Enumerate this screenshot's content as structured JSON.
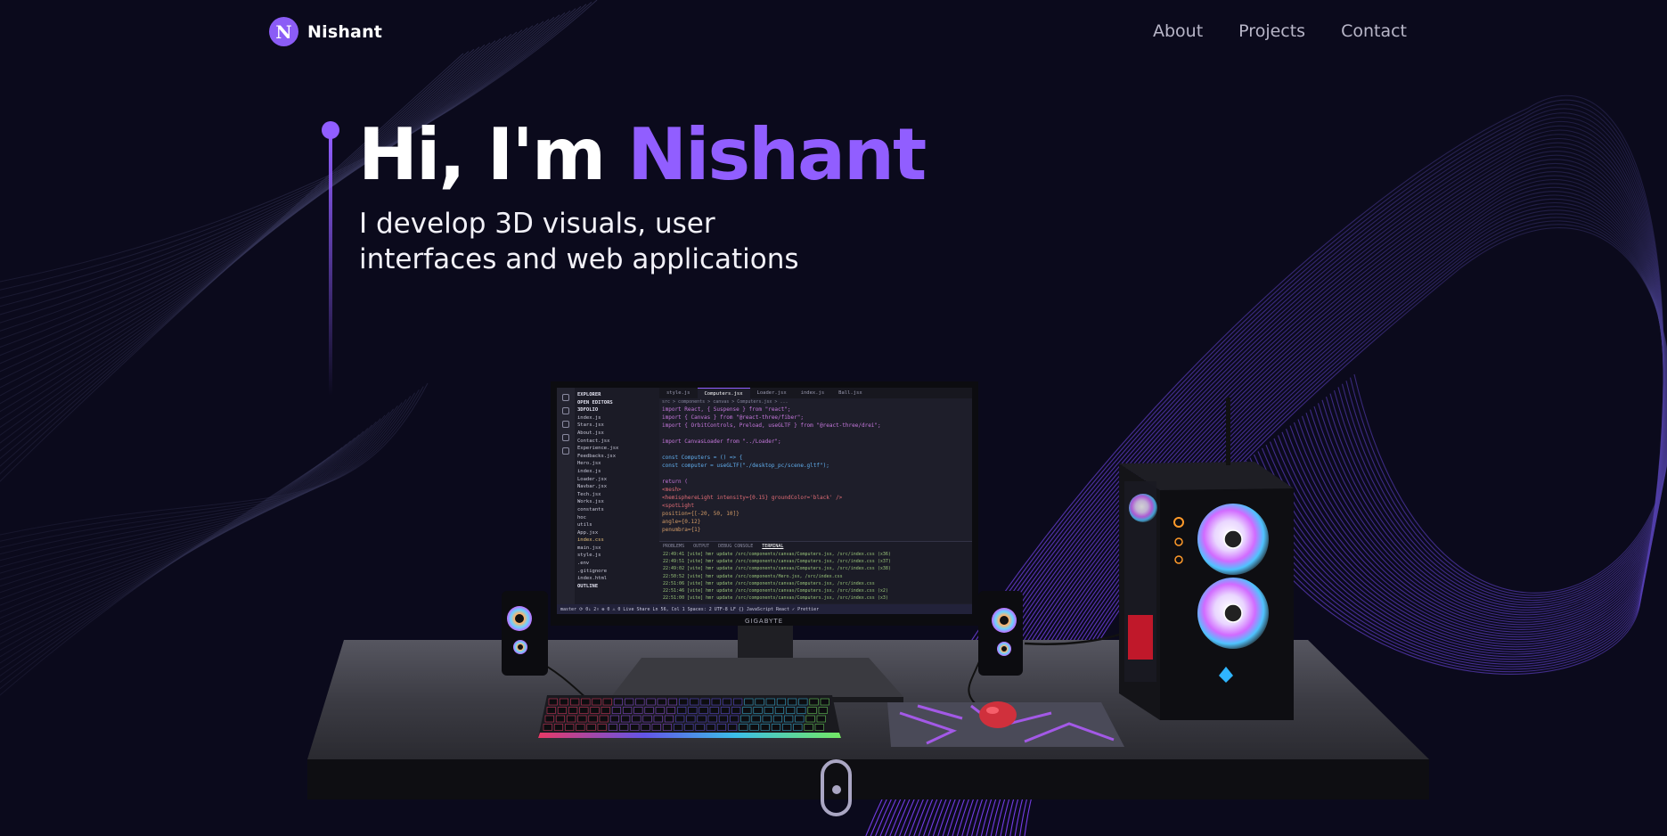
{
  "brand": {
    "initial": "N",
    "name": "Nishant"
  },
  "nav": {
    "links": [
      "About",
      "Projects",
      "Contact"
    ]
  },
  "hero": {
    "greeting": "Hi, I'm ",
    "name": "Nishant",
    "subtitle_line1": "I develop 3D visuals, user",
    "subtitle_line2": "interfaces and web applications"
  },
  "colors": {
    "accent": "#915eff",
    "background": "#0b0a1c",
    "nav_text": "#b8b6c8"
  },
  "icons": {
    "scroll": "scroll-indicator-icon"
  },
  "monitor": {
    "brand": "GIGABYTE",
    "explorer": {
      "title": "EXPLORER",
      "section_open": "OPEN EDITORS",
      "section_project": "3DFOLIO",
      "files": [
        "index.js",
        "Stars.jsx",
        "About.jsx",
        "Contact.jsx",
        "Experience.jsx",
        "Feedbacks.jsx",
        "Hero.jsx",
        "index.js",
        "Loader.jsx",
        "Navbar.jsx",
        "Tech.jsx",
        "Works.jsx",
        "constants",
        "hoc",
        "utils",
        "App.jsx",
        "index.css",
        "main.jsx",
        "style.js",
        ".env",
        ".gitignore",
        "index.html"
      ],
      "outline": "OUTLINE"
    },
    "tabs": [
      "style.js",
      "Computers.jsx",
      "Loader.jsx",
      "index.js",
      "Ball.jsx"
    ],
    "breadcrumb": "src > components > canvas > Computers.jsx > ...",
    "code": [
      "import React, { Suspense } from \"react\";",
      "import { Canvas } from \"@react-three/fiber\";",
      "import { OrbitControls, Preload, useGLTF } from \"@react-three/drei\";",
      "",
      "import CanvasLoader from \"../Loader\";",
      "",
      "const Computers = () => {",
      "  const computer = useGLTF(\"./desktop_pc/scene.gltf\");",
      "",
      "  return (",
      "    <mesh>",
      "      <hemisphereLight intensity={0.15} groundColor='black' />",
      "      <spotLight",
      "        position={[-20, 50, 10]}",
      "        angle={0.12}",
      "        penumbra={1}"
    ],
    "panel_tabs": [
      "PROBLEMS",
      "OUTPUT",
      "DEBUG CONSOLE",
      "TERMINAL"
    ],
    "terminal": [
      "22:49:41 [vite] hmr update /src/components/canvas/Computers.jsx, /src/index.css (x36)",
      "22:49:51 [vite] hmr update /src/components/canvas/Computers.jsx, /src/index.css (x37)",
      "22:49:02 [vite] hmr update /src/components/canvas/Computers.jsx, /src/index.css (x38)",
      "22:50:52 [vite] hmr update /src/components/Hero.jsx, /src/index.css",
      "22:51:06 [vite] hmr update /src/components/canvas/Computers.jsx, /src/index.css",
      "22:51:46 [vite] hmr update /src/components/canvas/Computers.jsx, /src/index.css (x2)",
      "22:51:00 [vite] hmr update /src/components/canvas/Computers.jsx, /src/index.css (x3)"
    ],
    "status": "master  ⟳ 0↓ 2↑   ⊗ 0 ⚠ 0   Live Share          Ln 56, Col 1   Spaces: 2   UTF-8   LF   {} JavaScript React   ✓ Prettier"
  }
}
